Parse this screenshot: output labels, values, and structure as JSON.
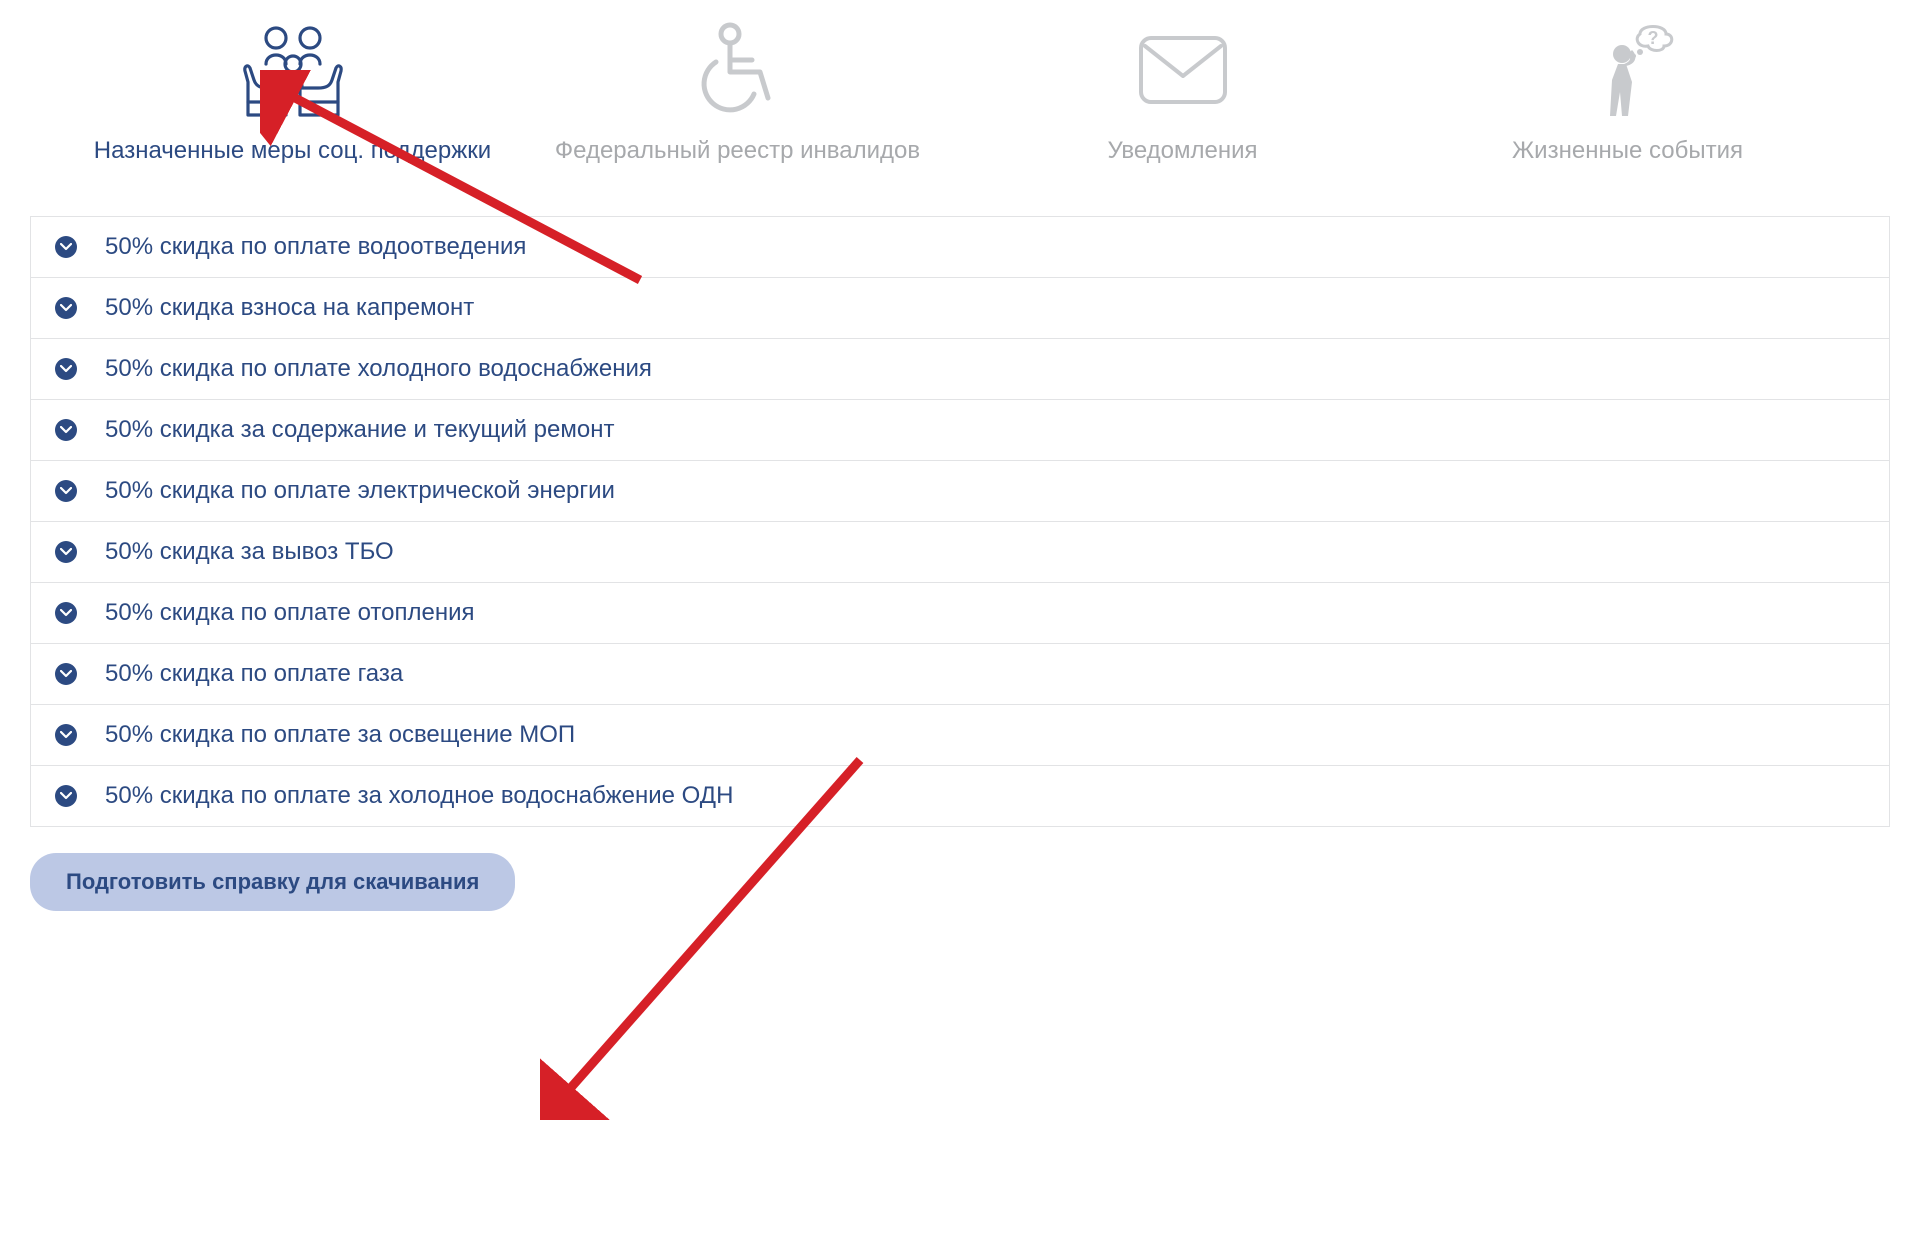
{
  "tabs": [
    {
      "label": "Назначенные меры соц. поддержки",
      "active": true
    },
    {
      "label": "Федеральный реестр инвалидов",
      "active": false
    },
    {
      "label": "Уведомления",
      "active": false
    },
    {
      "label": "Жизненные события",
      "active": false
    }
  ],
  "discounts": [
    {
      "label": "50% скидка по оплате водоотведения"
    },
    {
      "label": "50% скидка взноса на капремонт"
    },
    {
      "label": "50% скидка по оплате холодного водоснабжения"
    },
    {
      "label": "50% скидка за содержание и текущий ремонт"
    },
    {
      "label": "50% скидка по оплате электрической энергии"
    },
    {
      "label": "50% скидка за вывоз ТБО"
    },
    {
      "label": "50% скидка по оплате отопления"
    },
    {
      "label": "50% скидка по оплате газа"
    },
    {
      "label": "50% скидка по оплате за освещение МОП"
    },
    {
      "label": "50% скидка по оплате за холодное водоснабжение ОДН"
    }
  ],
  "download_button": {
    "label": "Подготовить справку для скачивания"
  },
  "colors": {
    "accent": "#2c4a82",
    "muted": "#a7a9ac",
    "button_bg": "#bcc8e5",
    "arrow": "#d62027"
  }
}
